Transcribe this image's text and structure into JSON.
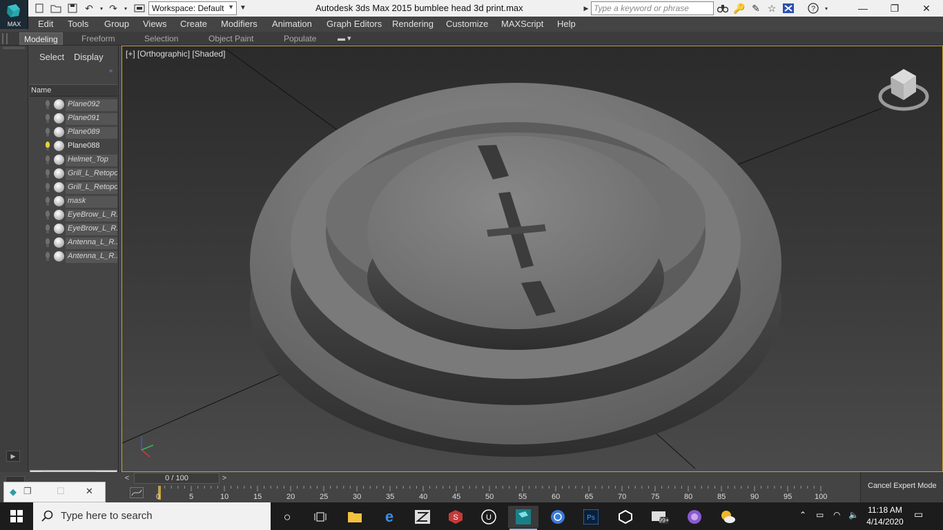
{
  "title_bar": {
    "app_logo_label": "MAX",
    "workspace_value": "Workspace: Default",
    "app_title": "Autodesk 3ds Max  2015     bumblee head 3d print.max",
    "search_placeholder": "Type a keyword or phrase"
  },
  "menu": [
    "Edit",
    "Tools",
    "Group",
    "Views",
    "Create",
    "Modifiers",
    "Animation",
    "Graph Editors",
    "Rendering",
    "Customize",
    "MAXScript",
    "Help"
  ],
  "ribbon_tabs": [
    {
      "label": "Modeling",
      "active": true
    },
    {
      "label": "Freeform",
      "active": false
    },
    {
      "label": "Selection",
      "active": false
    },
    {
      "label": "Object Paint",
      "active": false
    },
    {
      "label": "Populate",
      "active": false
    }
  ],
  "explorer": {
    "tabs": [
      "Select",
      "Display"
    ],
    "column_header": "Name",
    "objects": [
      {
        "name": "Plane092",
        "lit": false
      },
      {
        "name": "Plane091",
        "lit": false
      },
      {
        "name": "Plane089",
        "lit": false
      },
      {
        "name": "Plane088",
        "lit": true
      },
      {
        "name": "Helmet_Top",
        "lit": false
      },
      {
        "name": "Grill_L_Retopo",
        "lit": false
      },
      {
        "name": "Grill_L_Retopo",
        "lit": false
      },
      {
        "name": "mask",
        "lit": false
      },
      {
        "name": "EyeBrow_L_R...",
        "lit": false
      },
      {
        "name": "EyeBrow_L_R...",
        "lit": false
      },
      {
        "name": "Antenna_L_R...",
        "lit": false
      },
      {
        "name": "Antenna_L_R...",
        "lit": false
      }
    ]
  },
  "viewport": {
    "label": "[+] [Orthographic] [Shaded]",
    "border_color": "#c6a23a"
  },
  "timeline": {
    "frame_display": "0 / 100",
    "prev_arrow": "<",
    "next_arrow": ">",
    "ticks": [
      "0",
      "5",
      "10",
      "15",
      "20",
      "25",
      "30",
      "35",
      "40",
      "45",
      "50",
      "55",
      "60",
      "65",
      "70",
      "75",
      "80",
      "85",
      "90",
      "95",
      "100"
    ]
  },
  "cancel_expert_mode": "Cancel Expert Mode",
  "taskbar": {
    "search_placeholder": "Type here to search",
    "badge": "99+",
    "time": "11:18 AM",
    "date": "4/14/2020"
  }
}
